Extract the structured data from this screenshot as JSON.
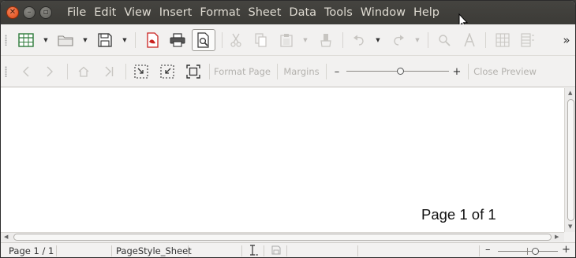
{
  "menubar": {
    "items": [
      "File",
      "Edit",
      "View",
      "Insert",
      "Format",
      "Sheet",
      "Data",
      "Tools",
      "Window",
      "Help"
    ]
  },
  "toolbar_standard": {
    "overflow": "»",
    "icons": [
      "spreadsheet-new-icon",
      "folder-open-icon",
      "save-icon",
      "export-pdf-icon",
      "print-icon",
      "print-preview-icon",
      "cut-icon",
      "copy-icon",
      "paste-icon",
      "clone-formatting-icon",
      "undo-icon",
      "redo-icon",
      "find-icon",
      "spelling-icon",
      "row-icon",
      "column-icon"
    ]
  },
  "toolbar_preview": {
    "format_page_label": "Format Page",
    "margins_label": "Margins",
    "zoom_minus": "–",
    "zoom_plus": "+",
    "zoom_value": 0.53,
    "close_preview_label": "Close Preview"
  },
  "document": {
    "page_label": "Page 1 of 1"
  },
  "statusbar": {
    "page": "Page 1 / 1",
    "page_style": "PageStyle_Sheet",
    "zoom_minus": "–",
    "zoom_plus": "+",
    "zoom_value": 0.5
  },
  "colors": {
    "titlebar": "#3c3b37",
    "close_button": "#dd4814",
    "toolbar_bg": "#f2f1f0",
    "disabled_text": "#b4b2ae"
  }
}
